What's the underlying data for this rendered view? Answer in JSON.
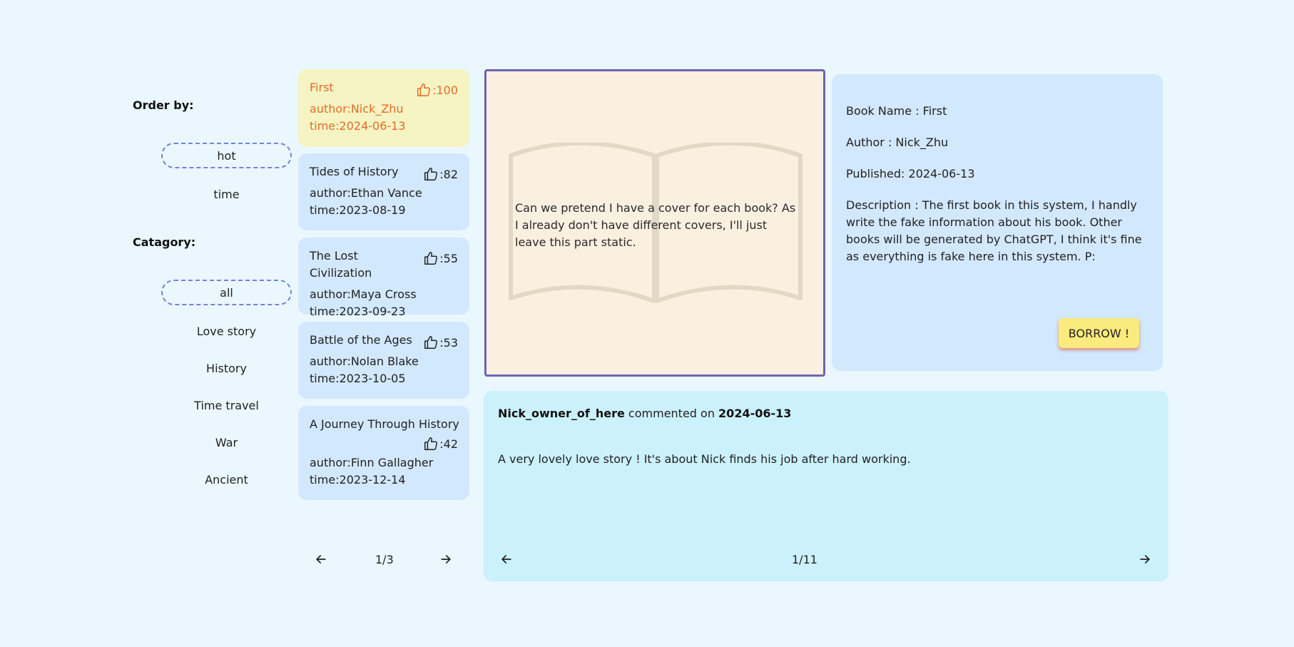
{
  "sidebar": {
    "order_title": "Order by:",
    "order_options": [
      "hot",
      "time"
    ],
    "order_selected": "hot",
    "category_title": "Catagory:",
    "category_options": [
      "all",
      "Love story",
      "History",
      "Time travel",
      "War",
      "Ancient"
    ],
    "category_selected": "all"
  },
  "books": [
    {
      "title": "First",
      "author": "author:Nick_Zhu",
      "time": "time:2024-06-13",
      "likes": ":100",
      "active": true
    },
    {
      "title": "Tides of History",
      "author": "author:Ethan Vance",
      "time": "time:2023-08-19",
      "likes": ":82"
    },
    {
      "title": "The Lost Civilization",
      "author": "author:Maya Cross",
      "time": "time:2023-09-23",
      "likes": ":55"
    },
    {
      "title": "Battle of the Ages",
      "author": "author:Nolan Blake",
      "time": "time:2023-10-05",
      "likes": ":53"
    },
    {
      "title": "A Journey Through History",
      "author": "author:Finn Gallagher",
      "time": "time:2023-12-14",
      "likes": ":42"
    }
  ],
  "book_pager": {
    "text": "1/3"
  },
  "cover": {
    "text": "Can we pretend I have a cover for each book? As I already don't have different covers, I'll just leave this part static."
  },
  "info": {
    "name": "Book Name : First",
    "author": "Author : Nick_Zhu",
    "published": "Published: 2024-06-13",
    "description": "Description : The first book in this system, I handly write the fake information about his book. Other books will be generated by ChatGPT, I think it's fine as everything is fake here in this system. P:",
    "borrow_label": "BORROW !"
  },
  "comment": {
    "user": "Nick_owner_of_here",
    "middle": " commented on ",
    "date": "2024-06-13",
    "body": "A very lovely love story ! It's about Nick finds his job after hard working."
  },
  "comment_pager": {
    "text": "1/11"
  },
  "icons": {
    "like": "thumbs-up-icon",
    "prev": "arrow-left-icon",
    "next": "arrow-right-icon"
  },
  "colors": {
    "background": "#eaf7ff",
    "card": "#d2e8fd",
    "active_card": "#f5f4c2",
    "active_text": "#e36c2b",
    "cover_border": "#6f63b3",
    "comment_bg": "#cbf1fd",
    "borrow": "#fbea7d",
    "selected_dash": "#7482dd"
  }
}
